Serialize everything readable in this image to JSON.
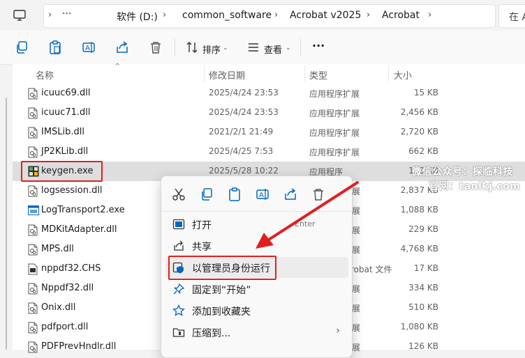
{
  "breadcrumb": {
    "items": [
      "软件 (D:)",
      "common_software",
      "Acrobat v2025",
      "Acrobat"
    ],
    "more_label": "···",
    "search_placeholder": "在 A"
  },
  "toolbar": {
    "sort_label": "排序",
    "view_label": "查看",
    "more_label": "···"
  },
  "columns": {
    "name": "名称",
    "date": "修改日期",
    "type": "类型",
    "size": "大小"
  },
  "files": [
    {
      "name": "icuuc69.dll",
      "date": "2025/4/24 23:53",
      "type": "应用程序扩展",
      "size": "15 KB",
      "icon": "dll-file-icon"
    },
    {
      "name": "icuuc71.dll",
      "date": "2025/4/24 23:53",
      "type": "应用程序扩展",
      "size": "2,456 KB",
      "icon": "dll-file-icon"
    },
    {
      "name": "IMSLib.dll",
      "date": "2021/2/1 21:49",
      "type": "应用程序扩展",
      "size": "2,720 KB",
      "icon": "dll-file-icon"
    },
    {
      "name": "JP2KLib.dll",
      "date": "2025/4/25 7:53",
      "type": "应用程序扩展",
      "size": "662 KB",
      "icon": "dll-file-icon"
    },
    {
      "name": "keygen.exe",
      "date": "2025/5/28 10:22",
      "type": "应用程序",
      "size": "158 KB",
      "icon": "exe-app-icon",
      "selected": true
    },
    {
      "name": "logsession.dll",
      "date": "",
      "type": "",
      "size": "2,837 KB",
      "icon": "dll-file-icon"
    },
    {
      "name": "LogTransport2.exe",
      "date": "",
      "type": "",
      "size": "1,088 KB",
      "icon": "exe-window-icon"
    },
    {
      "name": "MDKitAdapter.dll",
      "date": "",
      "type": "",
      "size": "229 KB",
      "icon": "dll-file-icon"
    },
    {
      "name": "MPS.dll",
      "date": "",
      "type": "",
      "size": "4,768 KB",
      "icon": "dll-file-icon"
    },
    {
      "name": "nppdf32.CHS",
      "date": "",
      "type": "",
      "size": "17 KB",
      "icon": "generic-file-icon"
    },
    {
      "name": "Nppdf32.dll",
      "date": "",
      "type": "",
      "size": "334 KB",
      "icon": "dll-file-icon"
    },
    {
      "name": "Onix.dll",
      "date": "",
      "type": "",
      "size": "510 KB",
      "icon": "dll-file-icon"
    },
    {
      "name": "pdfport.dll",
      "date": "",
      "type": "",
      "size": "1,080 KB",
      "icon": "dll-file-icon"
    },
    {
      "name": "PDFPrevHndlr.dll",
      "date": "",
      "type": "",
      "size": "126 KB",
      "icon": "dll-file-icon"
    }
  ],
  "partial_type_fragments": [
    "展",
    "展",
    "展",
    "展",
    "robat 文件",
    "展",
    "展",
    "展",
    "展"
  ],
  "context_menu": {
    "items": [
      {
        "label": "打开",
        "accelerator": "Enter",
        "icon": "open-icon"
      },
      {
        "label": "共享",
        "icon": "share-icon"
      },
      {
        "label": "以管理员身份运行",
        "icon": "admin-shield-icon"
      },
      {
        "label": "固定到“开始”",
        "icon": "pin-icon"
      },
      {
        "label": "添加到收藏夹",
        "icon": "star-icon"
      },
      {
        "label": "压缩到...",
        "icon": "zip-folder-icon",
        "submenu": "›"
      }
    ]
  },
  "watermark": {
    "line1": "微信公众号：探临科技",
    "line2": "官网：tanlkj.com"
  },
  "colors": {
    "highlight_red": "#e02020",
    "accent_blue": "#0067c0",
    "selection_gray": "#dedede"
  }
}
